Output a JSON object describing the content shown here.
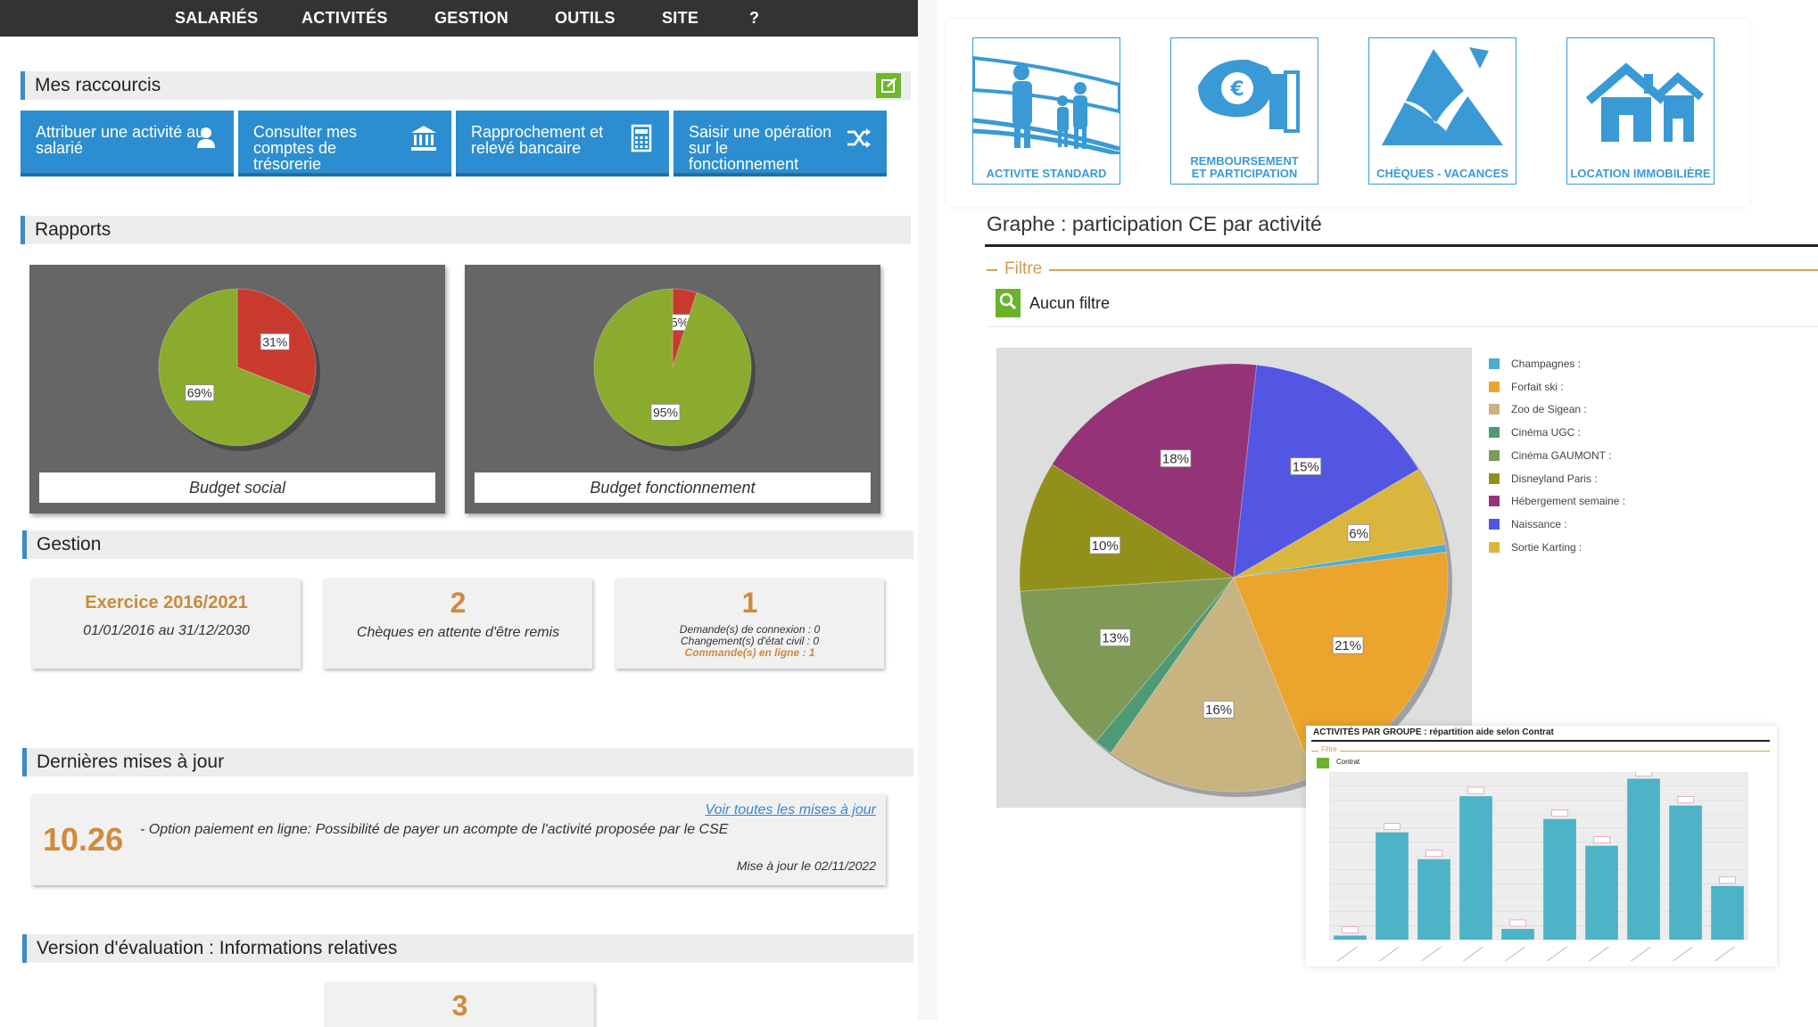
{
  "nav": {
    "items": [
      "SALARIÉS",
      "ACTIVITÉS",
      "GESTION",
      "OUTILS",
      "SITE",
      "?"
    ]
  },
  "shortcuts": {
    "title": "Mes raccourcis",
    "items": [
      {
        "label": "Attribuer une activité au salarié",
        "icon": "user-icon"
      },
      {
        "label": "Consulter mes comptes de trésorerie",
        "icon": "bank-icon"
      },
      {
        "label": "Rapprochement et relevé bancaire",
        "icon": "calculator-icon"
      },
      {
        "label": "Saisir une opération sur le fonctionnement",
        "icon": "shuffle-icon"
      }
    ],
    "edit_icon": "edit-icon"
  },
  "reports": {
    "title": "Rapports",
    "charts": [
      {
        "caption": "Budget social",
        "slices": [
          {
            "label": "69%",
            "value": 69,
            "color": "#8bab2e"
          },
          {
            "label": "31%",
            "value": 31,
            "color": "#c93a2e"
          }
        ]
      },
      {
        "caption": "Budget fonctionnement",
        "slices": [
          {
            "label": "95%",
            "value": 95,
            "color": "#8bab2e"
          },
          {
            "label": "5%",
            "value": 5,
            "color": "#c93a2e"
          }
        ]
      }
    ]
  },
  "gestion": {
    "title": "Gestion",
    "exercise": {
      "title": "Exercice 2016/2021",
      "period": "01/01/2016 au 31/12/2030"
    },
    "cheques": {
      "count": "2",
      "label": "Chèques en attente d'être remis"
    },
    "requests": {
      "count": "1",
      "line1": "Demande(s) de connexion : 0",
      "line2": "Changement(s) d'état civil : 0",
      "line3": "Commande(s) en ligne : 1"
    }
  },
  "updates": {
    "title": "Dernières mises à jour",
    "version": "10.26",
    "link": "Voir toutes les mises à jour",
    "text": "- Option paiement en ligne: Possibilité de payer un acompte de l'activité proposée par le CSE",
    "date": "Mise à jour le 02/11/2022"
  },
  "evaluation": {
    "title": "Version d'évaluation : Informations relatives",
    "count": "3"
  },
  "tiles": [
    {
      "label": "ACTIVITE STANDARD",
      "icon": "film-family-icon"
    },
    {
      "label": "REMBOURSEMENT ET PARTICIPATION",
      "icon": "euro-hand-icon"
    },
    {
      "label": "CHÈQUES - VACANCES",
      "icon": "mountain-bird-icon"
    },
    {
      "label": "LOCATION IMMOBILIÈRE",
      "icon": "houses-icon"
    }
  ],
  "graph": {
    "title": "Graphe : participation CE par activité",
    "filter_label": "Filtre",
    "filter_value": "Aucun filtre"
  },
  "chart_data": [
    {
      "type": "pie",
      "title": "Graphe : participation CE par activité",
      "legend_position": "right",
      "slices": [
        {
          "name": "Champagnes :",
          "value": 0.6,
          "label": "",
          "color": "#4aaed1"
        },
        {
          "name": "Forfait ski :",
          "value": 21,
          "label": "21%",
          "color": "#eba42c"
        },
        {
          "name": "Zoo de Sigean :",
          "value": 16,
          "label": "16%",
          "color": "#c8b481"
        },
        {
          "name": "Cinéma UGC :",
          "value": 1.4,
          "label": "",
          "color": "#4f9a76"
        },
        {
          "name": "Cinéma GAUMONT :",
          "value": 13,
          "label": "13%",
          "color": "#7e9a56"
        },
        {
          "name": "Disneyland Paris :",
          "value": 10,
          "label": "10%",
          "color": "#92901a"
        },
        {
          "name": "Hébergement semaine :",
          "value": 18,
          "label": "18%",
          "color": "#943378"
        },
        {
          "name": "Naissance :",
          "value": 15,
          "label": "15%",
          "color": "#5256e3"
        },
        {
          "name": "Sortie Karting :",
          "value": 6,
          "label": "6%",
          "color": "#dab63e"
        }
      ]
    },
    {
      "type": "bar",
      "title": "ACTIVITÉS PAR GROUPE : répartition aide selon Contrat",
      "filter_label": "Filtre",
      "filter_value": "Contrat",
      "values": [
        3,
        80,
        60,
        107,
        8,
        90,
        70,
        120,
        100,
        40
      ],
      "ylim": [
        0,
        125
      ],
      "color": "#4db3c6"
    }
  ]
}
